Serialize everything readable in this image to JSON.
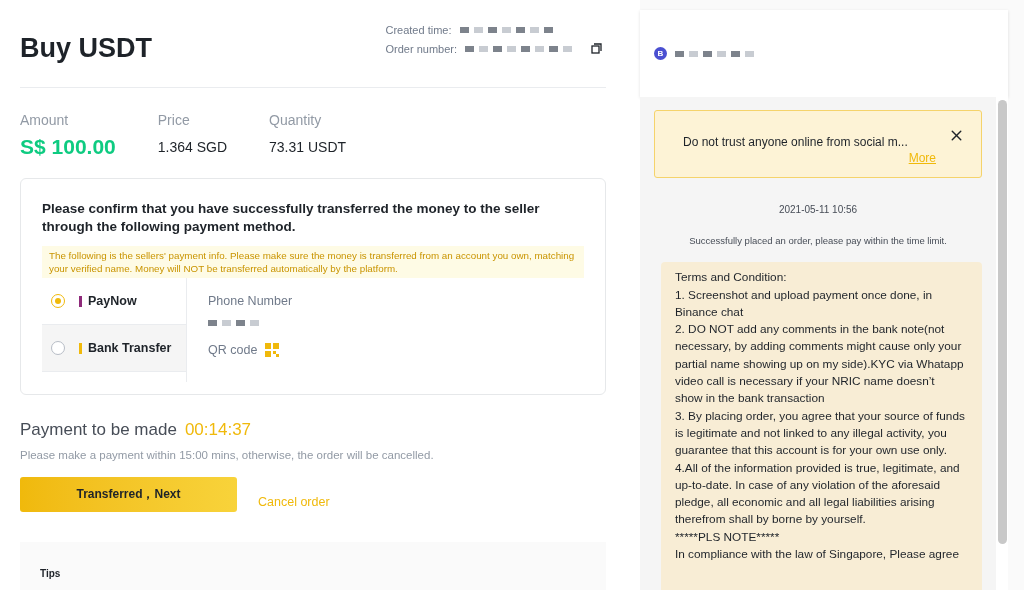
{
  "header": {
    "title": "Buy USDT",
    "created_label": "Created time:",
    "order_label": "Order number:"
  },
  "summary": [
    {
      "label": "Amount",
      "value": "S$ 100.00",
      "kind": "amount"
    },
    {
      "label": "Price",
      "value": "1.364 SGD",
      "kind": "plain"
    },
    {
      "label": "Quantity",
      "value": "73.31 USDT",
      "kind": "plain"
    }
  ],
  "confirm": {
    "title": "Please confirm that you have successfully transferred the money to the seller through the following payment method.",
    "notice": "The following is the sellers' payment info. Please make sure the money is transferred from an account you own, matching your verified name. Money will NOT be transferred automatically by the platform.",
    "methods": [
      {
        "label": "PayNow",
        "selected": true,
        "color": "#8e2a7a"
      },
      {
        "label": "Bank Transfer",
        "selected": false,
        "color": "#f0b90b"
      }
    ],
    "phone_label": "Phone Number",
    "qr_label": "QR code"
  },
  "payment": {
    "title": "Payment to be made",
    "timer": "00:14:37",
    "note": "Please make a payment within 15:00 mins, otherwise, the order will be cancelled.",
    "primary_button": "Transferred，Next",
    "cancel_link": "Cancel order"
  },
  "tips": {
    "title": "Tips"
  },
  "chat": {
    "avatar": "B",
    "warning": "Do not trust anyone online from social m...",
    "more": "More",
    "date": "2021-05-11 10:56",
    "system": "Successfully placed an order, please pay within the time limit.",
    "terms": [
      "Terms and Condition:",
      "1. Screenshot and upload payment once done, in Binance chat",
      "2. DO NOT add any comments in the bank note(not necessary, by adding comments might cause only your partial name showing up on my side).KYC via Whatapp video call is necessary if your NRIC name doesn’t show in the bank transaction",
      "3. By placing order, you agree that your source of funds is legitimate and not linked to any illegal activity, you guarantee that this account is for your own use only.",
      "4.All of the information provided is true, legitimate, and up-to-date. In case of any violation of the aforesaid pledge, all economic and all legal liabilities arising therefrom shall by borne by yourself.",
      "*****PLS NOTE*****",
      "In compliance with the law of Singapore, Please agree"
    ]
  }
}
